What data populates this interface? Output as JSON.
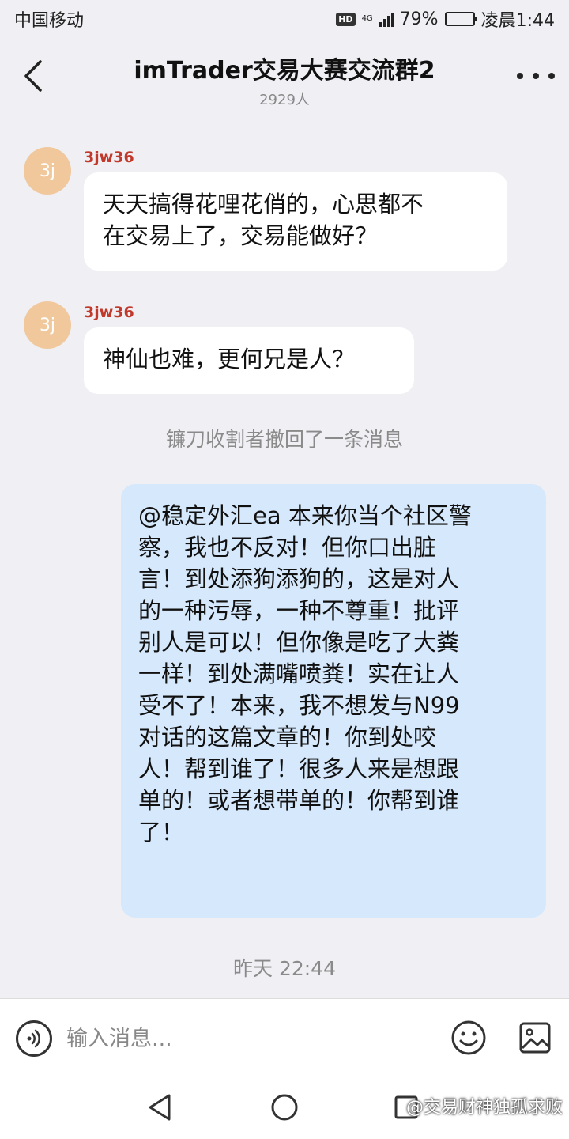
{
  "status_bar": {
    "carrier": "中国移动",
    "hd": "HD",
    "network": "4G",
    "battery": "79%",
    "battery_level": 0.79,
    "time": "凌晨1:44"
  },
  "header": {
    "title": "imTrader交易大赛交流群2",
    "subtitle": "2929人"
  },
  "messages": [
    {
      "avatar": "3j",
      "sender": "3jw36",
      "line1": "天天搞得花哩花俏的，心思都不",
      "line2": "在交易上了，交易能做好？"
    },
    {
      "avatar": "3j",
      "sender": "3jw36",
      "line1": "神仙也难，更何兄是人？"
    }
  ],
  "system_note": "镰刀收割者撤回了一条消息",
  "self_message": {
    "lines": [
      "@稳定外汇ea 本来你当个社区警",
      "察，我也不反对！但你口出脏",
      "言！到处添狗添狗的，这是对人",
      "的一种污辱，一种不尊重！批评",
      "别人是可以！但你像是吃了大粪",
      "一样！到处满嘴喷粪！实在让人",
      "受不了！本来，我不想发与N99",
      "对话的这篇文章的！你到处咬",
      "人！帮到谁了！很多人来是想跟",
      "单的！或者想带单的！你帮到谁",
      "了！"
    ]
  },
  "timestamp": "昨天 22:44",
  "input_bar": {
    "placeholder": "输入消息..."
  },
  "watermark": "@交易财神独孤求败",
  "icons": {
    "back": "chevron-left-icon",
    "more": "more-dots-icon",
    "voice": "voice-icon",
    "emoji": "emoji-icon",
    "image": "image-icon",
    "nav_back": "triangle-back-icon",
    "nav_home": "circle-home-icon",
    "nav_recent": "square-recent-icon"
  },
  "colors": {
    "background": "#efeff4",
    "incoming_bubble": "#ffffff",
    "outgoing_bubble": "#d6e8fb",
    "sender_name": "#c0392b",
    "avatar": "#f0c89c"
  }
}
